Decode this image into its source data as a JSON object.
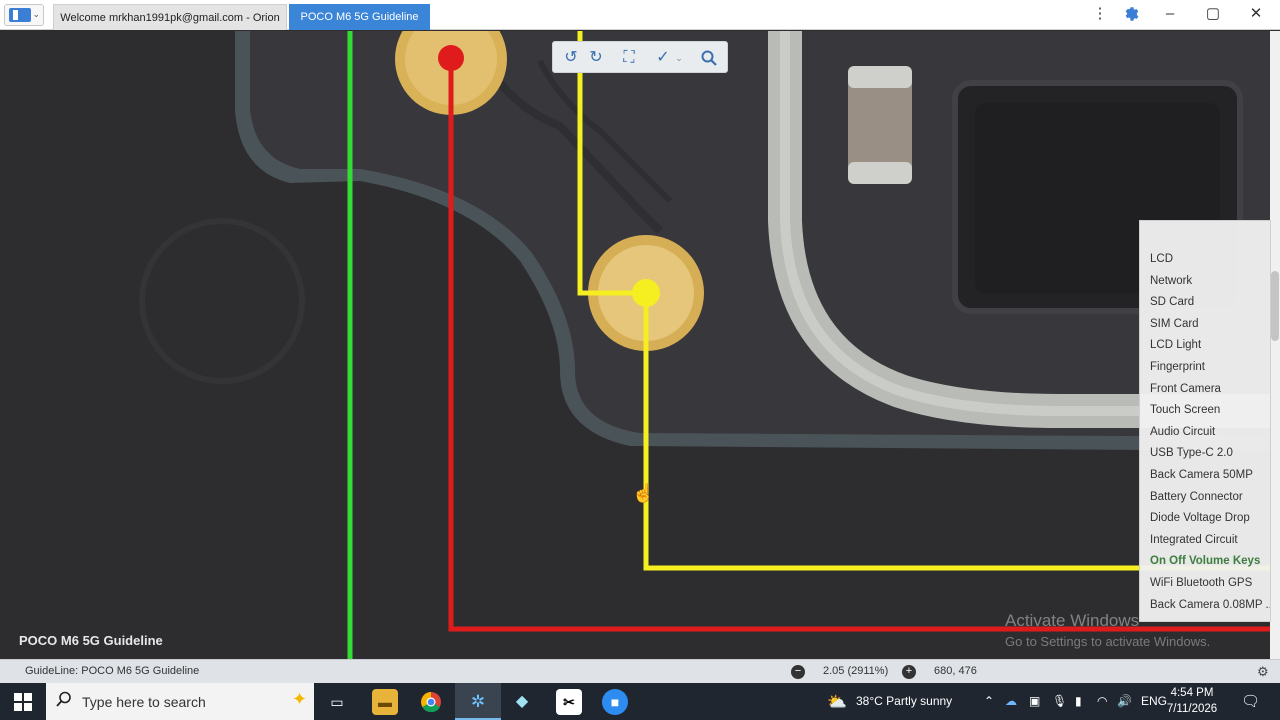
{
  "window": {
    "tabs": [
      {
        "label": "Welcome mrkhan1991pk@gmail.com - Orion"
      },
      {
        "label": "POCO M6 5G Guideline"
      }
    ],
    "controls": {
      "more": "⋮",
      "minimize": "–",
      "maximize": "▢",
      "close": "✕"
    }
  },
  "viewer": {
    "overlay_title": "POCO M6 5G Guideline",
    "toolbar_icons": [
      "rotate-left-icon",
      "rotate-right-icon",
      "fit-screen-icon",
      "check-draw-icon",
      "zoom-icon"
    ],
    "watermark": {
      "line1": "Activate Windows",
      "line2": "Go to Settings to activate Windows."
    },
    "trace_colors": {
      "green": "#33dd33",
      "red": "#e01b1b",
      "yellow": "#f5ee20"
    }
  },
  "menu": {
    "items": [
      "LCD",
      "Network",
      "SD Card",
      "SIM Card",
      "LCD Light",
      "Fingerprint",
      "Front Camera",
      "Touch Screen",
      "Audio Circuit",
      "USB Type-C 2.0",
      "Back Camera 50MP",
      "Battery Connector",
      "Diode Voltage Drop",
      "Integrated Circuit",
      "On Off Volume Keys",
      "WiFi Bluetooth GPS",
      "Back Camera 0.08MP ..."
    ],
    "active_item": "On Off Volume Keys"
  },
  "status": {
    "guideline": "GuideLine: POCO M6 5G Guideline",
    "zoom": "2.05 (2911%)",
    "coords": "680, 476"
  },
  "taskbar": {
    "search_placeholder": "Type here to search",
    "weather": "38°C  Partly sunny",
    "language": "ENG",
    "time": "4:54 PM",
    "date": "7/11/2026"
  }
}
